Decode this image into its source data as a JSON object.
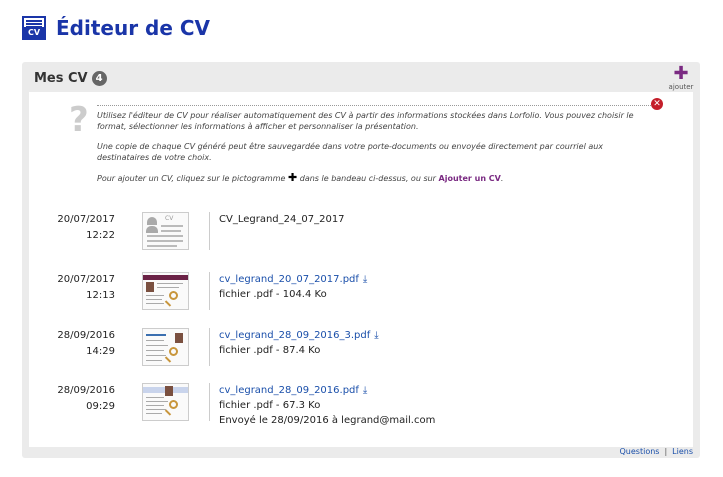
{
  "app": {
    "title": "Éditeur de CV",
    "logo_text": "CV"
  },
  "panel": {
    "title": "Mes CV",
    "count": "4",
    "add_label": "ajouter"
  },
  "help": {
    "question_mark": "?",
    "paragraph1": "Utilisez l'éditeur de CV pour réaliser automatiquement des CV à partir des informations stockées dans Lorfolio. Vous pouvez choisir le format, sélectionner les informations à afficher et personnaliser la présentation.",
    "paragraph2": "Une copie de chaque CV généré peut être sauvegardée dans votre porte-documents ou envoyée directement par courriel aux destinataires de votre choix.",
    "paragraph3_before": "Pour ajouter un CV, cliquez sur le pictogramme",
    "paragraph3_middle": "dans le bandeau ci-dessus, ou sur",
    "paragraph3_link": "Ajouter un CV",
    "paragraph3_after": "."
  },
  "cvs": [
    {
      "date": "20/07/2017",
      "time": "12:22",
      "name": "CV_Legrand_24_07_2017"
    },
    {
      "date": "20/07/2017",
      "time": "12:13",
      "name": "cv_legrand_20_07_2017.pdf",
      "meta": "fichier .pdf - 104.4 Ko"
    },
    {
      "date": "28/09/2016",
      "time": "14:29",
      "name": "cv_legrand_28_09_2016_3.pdf",
      "meta": "fichier .pdf - 87.4 Ko"
    },
    {
      "date": "28/09/2016",
      "time": "09:29",
      "name": "cv_legrand_28_09_2016.pdf",
      "meta": "fichier .pdf - 67.3 Ko",
      "sent": "Envoyé le 28/09/2016 à legrand@mail.com"
    }
  ],
  "footer": {
    "questions": "Questions",
    "separator": "|",
    "links": "Liens"
  },
  "colors": {
    "brand_blue": "#1a35a8",
    "accent_purple": "#7a2a82",
    "link_blue": "#1a4faa",
    "close_red": "#c41e2a"
  },
  "icons": {
    "add": "plus-icon",
    "close": "close-icon",
    "download": "download-icon",
    "help": "question-icon"
  }
}
